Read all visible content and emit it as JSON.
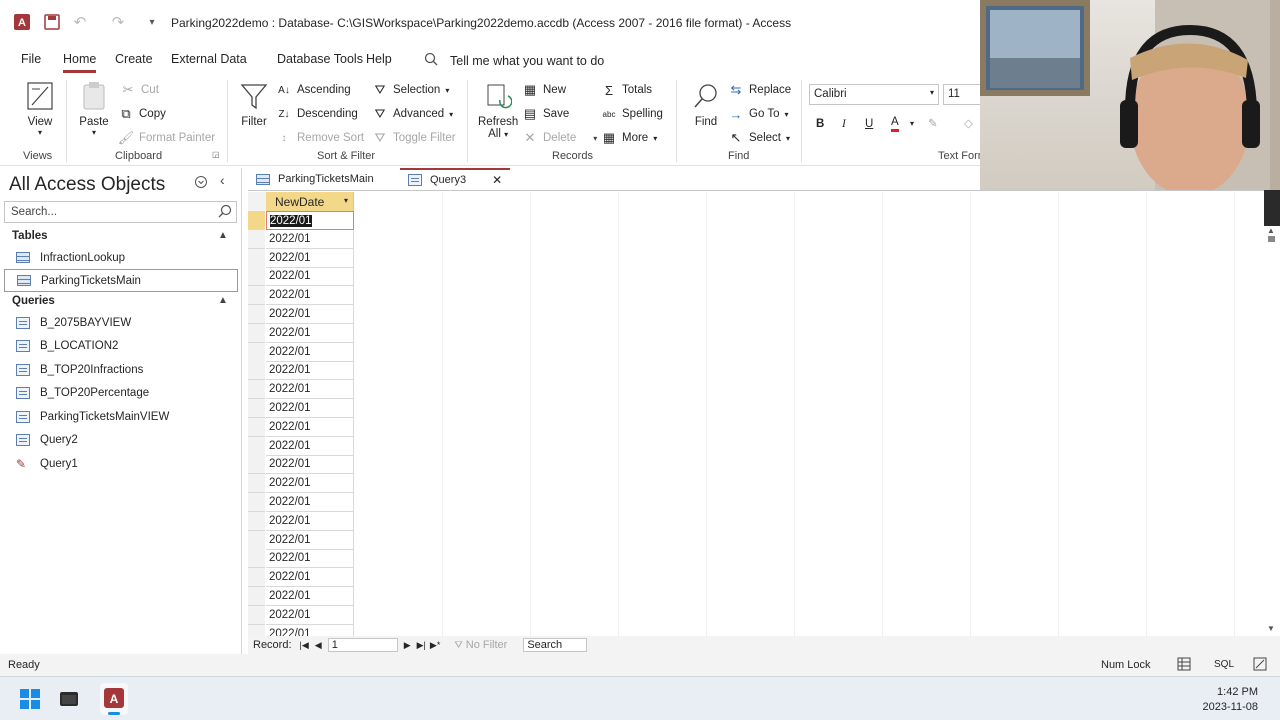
{
  "titlebar": {
    "title": "Parking2022demo : Database- C:\\GISWorkspace\\Parking2022demo.accdb (Access 2007 - 2016 file format)  -  Access"
  },
  "menu": {
    "items": [
      "File",
      "Home",
      "Create",
      "External Data",
      "Database Tools",
      "Help"
    ],
    "tell_me": "Tell me what you want to do"
  },
  "ribbon": {
    "views": {
      "view": "View",
      "group": "Views"
    },
    "clipboard": {
      "paste": "Paste",
      "cut": "Cut",
      "copy": "Copy",
      "format_painter": "Format Painter",
      "group": "Clipboard"
    },
    "sort_filter": {
      "filter": "Filter",
      "ascending": "Ascending",
      "descending": "Descending",
      "remove_sort": "Remove Sort",
      "selection": "Selection",
      "advanced": "Advanced",
      "toggle_filter": "Toggle Filter",
      "group": "Sort & Filter"
    },
    "records": {
      "refresh": "Refresh",
      "all": "All",
      "new": "New",
      "save": "Save",
      "delete": "Delete",
      "totals": "Totals",
      "spelling": "Spelling",
      "more": "More",
      "group": "Records"
    },
    "find": {
      "find": "Find",
      "replace": "Replace",
      "goto": "Go To",
      "select": "Select",
      "group": "Find"
    },
    "text_formatting": {
      "font": "Calibri",
      "size": "11",
      "bold": "B",
      "italic": "I",
      "underline": "U",
      "font_color": "A",
      "group": "Text Form"
    }
  },
  "nav": {
    "header": "All Access Objects",
    "search_placeholder": "Search...",
    "tables_label": "Tables",
    "tables": [
      "InfractionLookup",
      "ParkingTicketsMain"
    ],
    "queries_label": "Queries",
    "queries": [
      "B_2075BAYVIEW",
      "B_LOCATION2",
      "B_TOP20Infractions",
      "B_TOP20Percentage",
      "ParkingTicketsMainVIEW",
      "Query2",
      "Query1"
    ]
  },
  "tabs": [
    "ParkingTicketsMain",
    "Query3"
  ],
  "datasheet": {
    "column": "NewDate",
    "rows": [
      "2022/01",
      "2022/01",
      "2022/01",
      "2022/01",
      "2022/01",
      "2022/01",
      "2022/01",
      "2022/01",
      "2022/01",
      "2022/01",
      "2022/01",
      "2022/01",
      "2022/01",
      "2022/01",
      "2022/01",
      "2022/01",
      "2022/01",
      "2022/01",
      "2022/01",
      "2022/01",
      "2022/01",
      "2022/01",
      "2022/01",
      "2022/01"
    ]
  },
  "record_nav": {
    "label": "Record:",
    "current": "1",
    "no_filter": "No Filter",
    "search": "Search"
  },
  "status": {
    "ready": "Ready",
    "num_lock": "Num Lock",
    "sql": "SQL"
  },
  "taskbar": {
    "time": "1:42 PM",
    "date": "2023-11-08"
  }
}
